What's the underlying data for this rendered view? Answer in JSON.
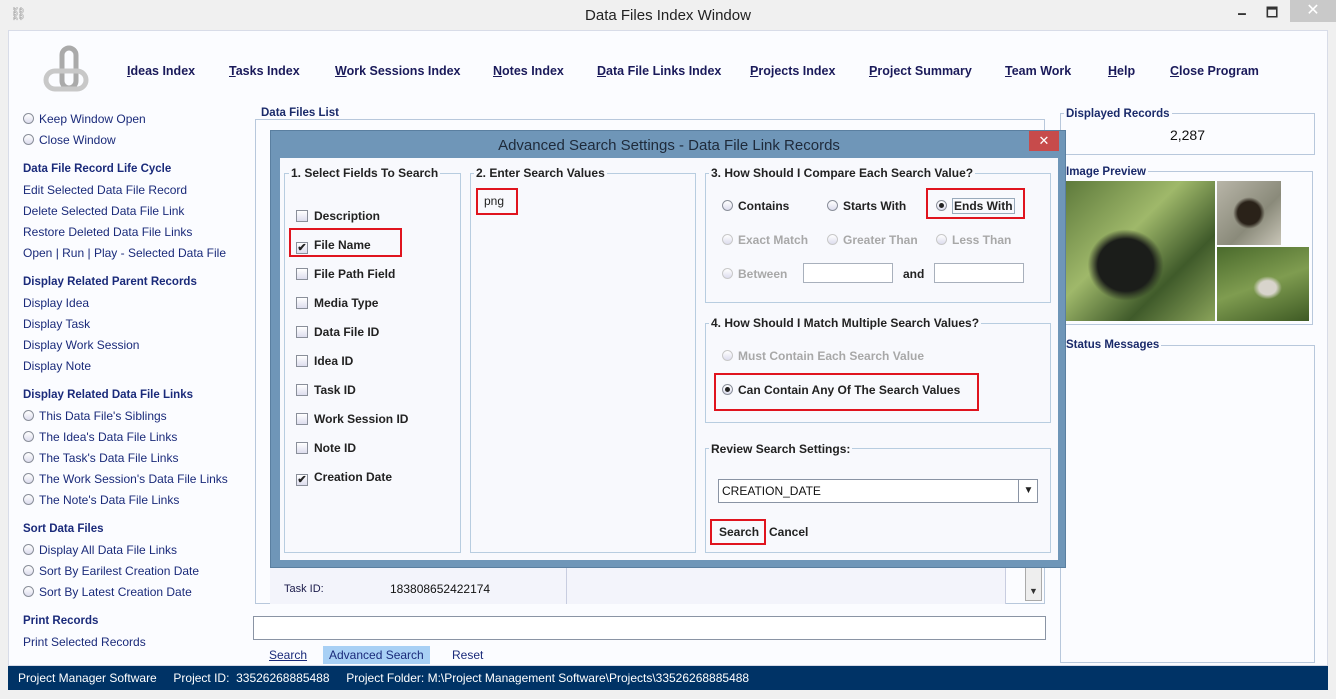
{
  "window": {
    "title": "Data Files Index Window",
    "minimize": "🗕",
    "maximize": "🗖",
    "close": "✕"
  },
  "nav": [
    "Ideas Index",
    "Tasks Index",
    "Work Sessions Index",
    "Notes Index",
    "Data File Links Index",
    "Projects Index",
    "Project Summary",
    "Team Work",
    "Help",
    "Close Program"
  ],
  "sidebar": {
    "window_options": [
      "Keep Window Open",
      "Close Window"
    ],
    "life_cycle": {
      "heading": "Data File Record Life Cycle",
      "items": [
        "Edit Selected Data File Record",
        "Delete Selected Data File Link",
        "Restore Deleted Data File Links",
        "Open | Run | Play - Selected Data File"
      ]
    },
    "parents": {
      "heading": "Display Related Parent Records",
      "items": [
        "Display Idea",
        "Display Task",
        "Display Work Session",
        "Display Note"
      ]
    },
    "links": {
      "heading": "Display Related Data File Links",
      "items": [
        "This Data File's Siblings",
        "The Idea's Data File Links",
        "The Task's Data File Links",
        "The Work Session's Data File Links",
        "The Note's Data File Links"
      ]
    },
    "sort": {
      "heading": "Sort Data Files",
      "items": [
        "Display All Data File Links",
        "Sort By Earilest Creation Date",
        "Sort By Latest Creation Date"
      ]
    },
    "print": {
      "heading": "Print Records",
      "items": [
        "Print Selected Records"
      ]
    }
  },
  "list": {
    "title": "Data Files List",
    "task_id_label": "Task ID:",
    "task_id_value": "183808652422174"
  },
  "search": {
    "value": "",
    "buttons": [
      "Search",
      "Advanced Search",
      "Reset"
    ]
  },
  "displayed_records": {
    "title": "Displayed Records",
    "count": "2,287"
  },
  "image_preview": {
    "title": "Image Preview"
  },
  "status_messages": {
    "title": "Status Messages"
  },
  "statusbar": {
    "app": "Project Manager Software",
    "project_id": "Project ID:  33526268885488",
    "folder": "Project Folder: M:\\Project Management Software\\Projects\\33526268885488"
  },
  "dialog": {
    "title": "Advanced Search Settings - Data File Link Records",
    "close": "✕",
    "fields_title": "1. Select Fields To Search",
    "fields": [
      {
        "label": "Description",
        "checked": false
      },
      {
        "label": "File Name",
        "checked": true
      },
      {
        "label": "File Path Field",
        "checked": false
      },
      {
        "label": "Media Type",
        "checked": false
      },
      {
        "label": "Data File ID",
        "checked": false
      },
      {
        "label": "Idea ID",
        "checked": false
      },
      {
        "label": "Task ID",
        "checked": false
      },
      {
        "label": "Work Session ID",
        "checked": false
      },
      {
        "label": "Note ID",
        "checked": false
      },
      {
        "label": "Creation Date",
        "checked": true
      }
    ],
    "values_title": "2. Enter Search Values",
    "search_value": "png",
    "compare_title": "3. How Should I Compare Each Search Value?",
    "compare": {
      "contains": "Contains",
      "starts": "Starts With",
      "ends": "Ends With",
      "exact": "Exact Match",
      "greater": "Greater Than",
      "less": "Less Than",
      "between": "Between",
      "and": "and",
      "selected": "Ends With"
    },
    "match_title": "4. How Should I Match Multiple Search Values?",
    "match": {
      "each": "Must Contain Each Search Value",
      "any": "Can Contain Any Of The Search Values",
      "selected": "Can Contain Any Of The Search Values"
    },
    "review_title": "Review Search Settings:",
    "review_value": "CREATION_DATE",
    "search_btn": "Search",
    "cancel_btn": "Cancel"
  },
  "colors": {
    "highlight": "#e0141e",
    "statusbar": "#003366",
    "dialog_frame": "#6f96b8",
    "selected_button": "#a8d0f5"
  }
}
